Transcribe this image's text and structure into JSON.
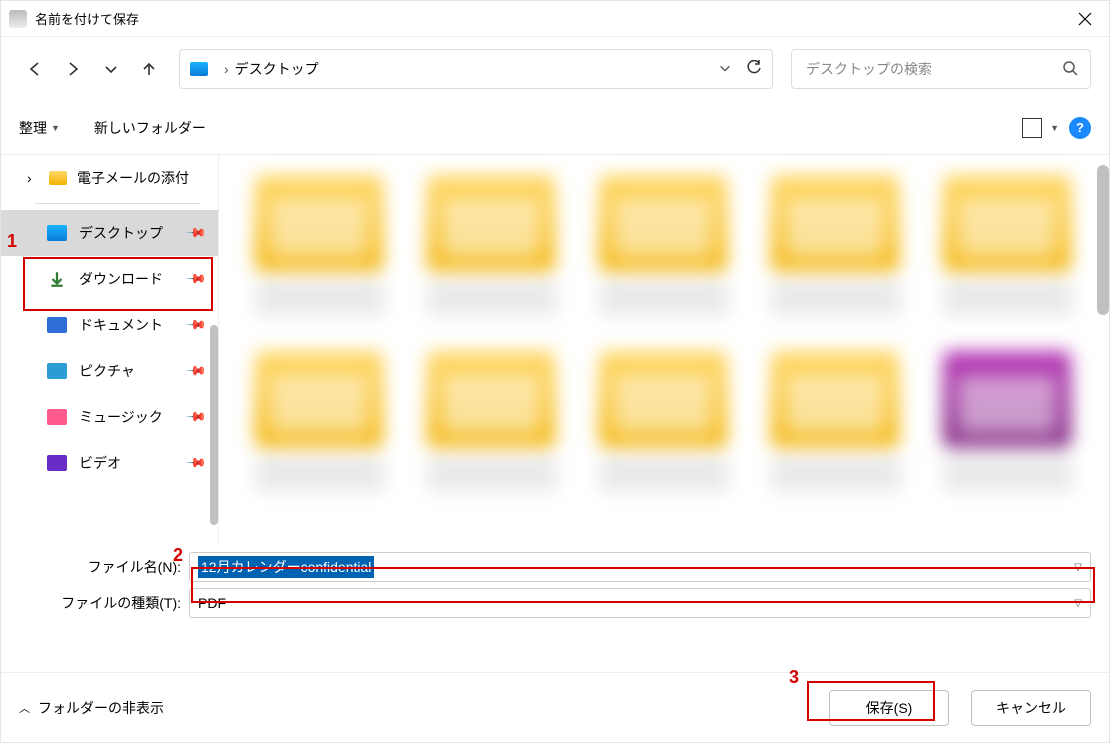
{
  "window": {
    "title": "名前を付けて保存"
  },
  "address": {
    "location": "デスクトップ"
  },
  "search": {
    "placeholder": "デスクトップの検索"
  },
  "toolbar": {
    "organize": "整理",
    "new_folder": "新しいフォルダー"
  },
  "tree": {
    "mail_attachments": "電子メールの添付"
  },
  "quick": {
    "desktop": "デスクトップ",
    "downloads": "ダウンロード",
    "documents": "ドキュメント",
    "pictures": "ピクチャ",
    "music": "ミュージック",
    "videos": "ビデオ"
  },
  "fields": {
    "filename_label": "ファイル名(N):",
    "filename_value": "12月カレンダーconfidential",
    "filetype_label": "ファイルの種類(T):",
    "filetype_value": "PDF"
  },
  "footer": {
    "hide_folders": "フォルダーの非表示",
    "save": "保存(S)",
    "cancel": "キャンセル"
  },
  "annotations": {
    "n1": "1",
    "n2": "2",
    "n3": "3"
  }
}
